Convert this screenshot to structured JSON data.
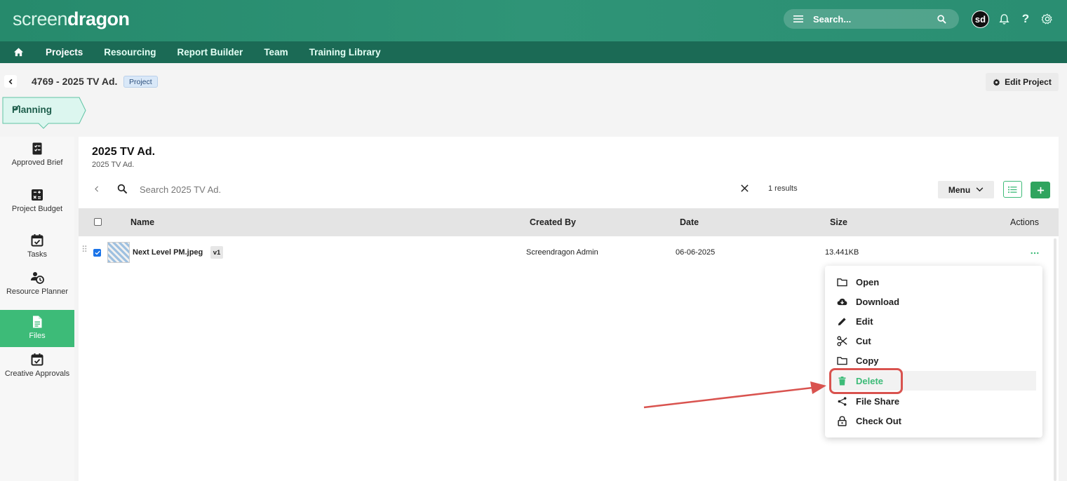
{
  "header": {
    "logo_light": "screen",
    "logo_bold": "dragon",
    "search_placeholder": "Search...",
    "avatar_initials": "sd"
  },
  "nav": {
    "items": [
      "Projects",
      "Resourcing",
      "Report Builder",
      "Team",
      "Training Library"
    ]
  },
  "project": {
    "title": "4769 - 2025 TV Ad.",
    "badge": "Project",
    "edit_label": "Edit Project",
    "stage": "Planning"
  },
  "sidebar": {
    "items": [
      {
        "label": "Approved Brief",
        "icon": "brief-icon"
      },
      {
        "label": "Project Budget",
        "icon": "calculator-icon"
      },
      {
        "label": "Tasks",
        "icon": "tasks-icon"
      },
      {
        "label": "Resource Planner",
        "icon": "resource-planner-icon"
      },
      {
        "label": "Files",
        "icon": "file-icon"
      },
      {
        "label": "Creative Approvals",
        "icon": "approvals-icon"
      }
    ],
    "active": "Files"
  },
  "panel": {
    "title": "2025 TV Ad.",
    "subtitle": "2025 TV Ad.",
    "search_placeholder": "Search 2025 TV Ad.",
    "results": "1 results",
    "menu_label": "Menu"
  },
  "table": {
    "columns": [
      "Name",
      "Created By",
      "Date",
      "Size",
      "Actions"
    ],
    "rows": [
      {
        "name": "Next Level PM.jpeg",
        "version": "v1",
        "created_by": "Screendragon Admin",
        "date": "06-06-2025",
        "size": "13.441KB",
        "checked": true
      }
    ]
  },
  "context_menu": {
    "items": [
      "Open",
      "Download",
      "Edit",
      "Cut",
      "Copy",
      "Delete",
      "File Share",
      "Check Out"
    ],
    "highlighted": "Delete"
  },
  "colors": {
    "header": "#2a8e72",
    "navbar": "#1b6a55",
    "accent": "#3dbb78",
    "annotation": "#d9534f"
  }
}
